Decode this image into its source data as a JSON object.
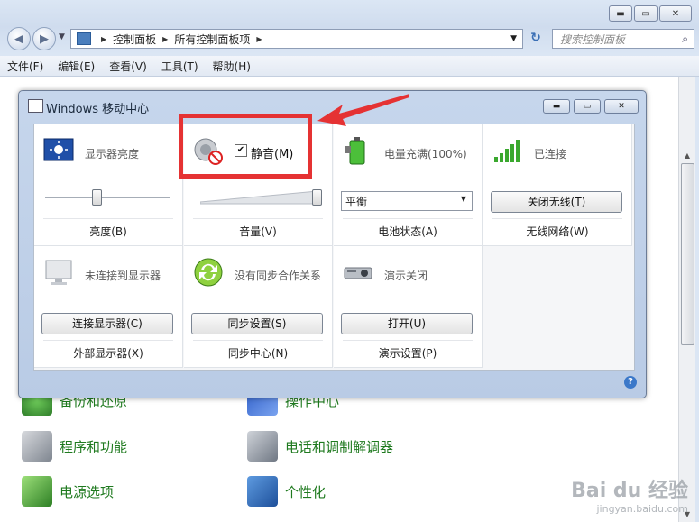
{
  "window": {
    "buttons": {
      "minimize": "▬",
      "maximize": "▭",
      "close": "✕"
    }
  },
  "nav": {
    "breadcrumbs": [
      "控制面板",
      "所有控制面板项"
    ],
    "search_placeholder": "搜索控制面板"
  },
  "menu": [
    "文件(F)",
    "编辑(E)",
    "查看(V)",
    "工具(T)",
    "帮助(H)"
  ],
  "cp_items": [
    {
      "label": "备份和还原",
      "icon": "backup-icon"
    },
    {
      "label": "操作中心",
      "icon": "flag-icon"
    },
    {
      "label": "程序和功能",
      "icon": "programs-icon"
    },
    {
      "label": "电话和调制解调器",
      "icon": "phone-icon"
    },
    {
      "label": "电源选项",
      "icon": "battery-icon"
    },
    {
      "label": "个性化",
      "icon": "monitor-icon"
    }
  ],
  "dialog": {
    "title": "Windows 移动中心",
    "tiles": {
      "brightness": {
        "head": "显示器亮度",
        "foot": "亮度(B)",
        "level": 0.4
      },
      "volume": {
        "mute_label": "静音(M)",
        "muted": true,
        "foot": "音量(V)",
        "level": 1.0
      },
      "battery": {
        "head": "电量充满(100%)",
        "plan": "平衡",
        "foot": "电池状态(A)"
      },
      "wireless": {
        "head": "已连接",
        "button": "关闭无线(T)",
        "foot": "无线网络(W)"
      },
      "display": {
        "head": "未连接到显示器",
        "button": "连接显示器(C)",
        "foot": "外部显示器(X)"
      },
      "sync": {
        "head": "没有同步合作关系",
        "button": "同步设置(S)",
        "foot": "同步中心(N)"
      },
      "presentation": {
        "head": "演示关闭",
        "button": "打开(U)",
        "foot": "演示设置(P)"
      }
    },
    "help": "?"
  },
  "watermark": {
    "brand": "Bai du 经验",
    "url": "jingyan.baidu.com"
  },
  "colors": {
    "highlight": "#e53233",
    "link": "#1f7a1f"
  }
}
